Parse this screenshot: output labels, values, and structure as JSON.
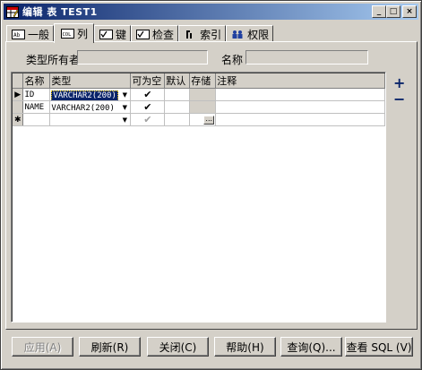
{
  "window": {
    "title": "编辑 表 TEST1",
    "minimize": "_",
    "maximize": "□",
    "close": "×"
  },
  "tabs": [
    {
      "icon": "general-icon",
      "label": "一般"
    },
    {
      "icon": "columns-icon",
      "label": "列"
    },
    {
      "icon": "keys-icon",
      "label": "键"
    },
    {
      "icon": "checks-icon",
      "label": "检查"
    },
    {
      "icon": "index-icon",
      "label": "索引"
    },
    {
      "icon": "privileges-icon",
      "label": "权限"
    }
  ],
  "active_tab": "列",
  "form": {
    "type_owner_label": "类型所有者",
    "type_owner_value": "",
    "name_label": "名称",
    "name_value": ""
  },
  "grid": {
    "headers": [
      "名称",
      "类型",
      "可为空",
      "默认",
      "存储",
      "注释"
    ],
    "rows": [
      {
        "indicator": "▶",
        "name": "ID",
        "type": "VARCHAR2(200)",
        "nullable": true,
        "default": "",
        "storage": "",
        "comment": ""
      },
      {
        "indicator": "",
        "name": "NAME",
        "type": "VARCHAR2(200)",
        "nullable": true,
        "default": "",
        "storage": "",
        "comment": ""
      },
      {
        "indicator": "✱",
        "name": "",
        "type": "",
        "nullable": true,
        "default": "",
        "storage": "...",
        "comment": ""
      }
    ],
    "add_icon": "plus-icon",
    "remove_icon": "minus-icon"
  },
  "buttons": {
    "apply": "应用(A)",
    "refresh": "刷新(R)",
    "close": "关闭(C)",
    "help": "帮助(H)",
    "query": "查询(Q)...",
    "view_sql": "查看 SQL (V)"
  }
}
